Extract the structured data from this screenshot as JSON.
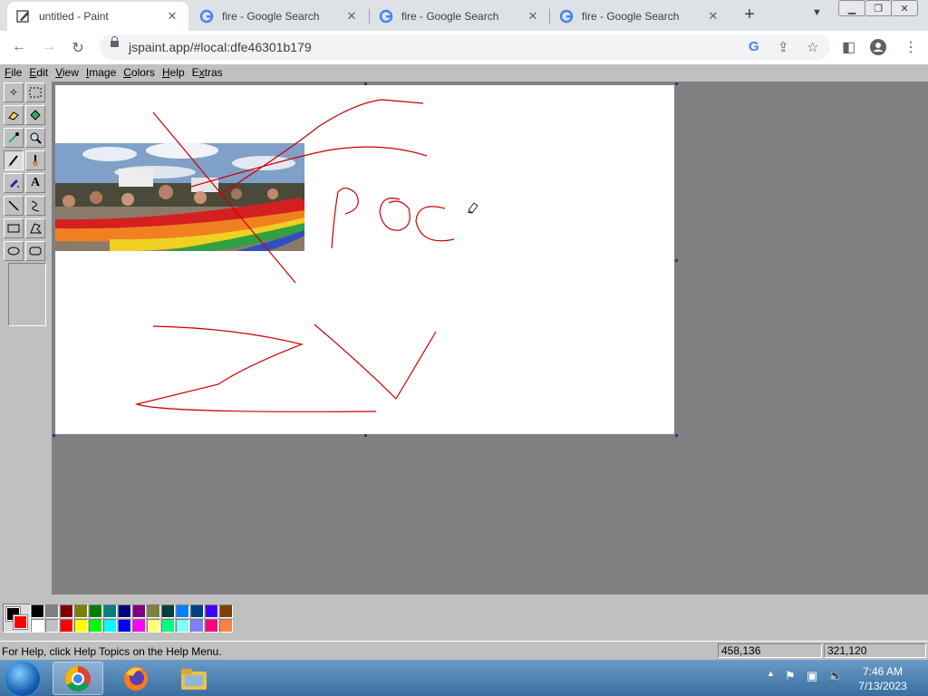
{
  "browser": {
    "tabs": [
      {
        "title": "untitled - Paint",
        "active": true
      },
      {
        "title": "fire - Google Search",
        "active": false
      },
      {
        "title": "fire - Google Search",
        "active": false
      },
      {
        "title": "fire - Google Search",
        "active": false
      }
    ],
    "new_tab": "+",
    "url": "jspaint.app/#local:dfe46301b179"
  },
  "paint": {
    "menus": [
      "File",
      "Edit",
      "View",
      "Image",
      "Colors",
      "Help",
      "Extras"
    ],
    "menu_mnemonics": [
      "F",
      "E",
      "V",
      "I",
      "C",
      "H",
      "x"
    ],
    "text_tool_label": "A",
    "palette_colors": [
      "#000000",
      "#808080",
      "#800000",
      "#808000",
      "#008000",
      "#008080",
      "#000080",
      "#800080",
      "#808040",
      "#004040",
      "#0080ff",
      "#004080",
      "#4000ff",
      "#804000",
      "#ffffff",
      "#c0c0c0",
      "#ff0000",
      "#ffff00",
      "#00ff00",
      "#00ffff",
      "#0000ff",
      "#ff00ff",
      "#ffff80",
      "#00ff80",
      "#80ffff",
      "#8080ff",
      "#ff0080",
      "#ff8040"
    ],
    "foreground_color": "#000000",
    "background_color": "#ff0000",
    "drawing_color": "#cc0000"
  },
  "status": {
    "help_text": "For Help, click Help Topics on the Help Menu.",
    "cursor_position": "458,136",
    "selection_size": "321,120"
  },
  "taskbar": {
    "time": "7:46 AM",
    "date": "7/13/2023"
  }
}
